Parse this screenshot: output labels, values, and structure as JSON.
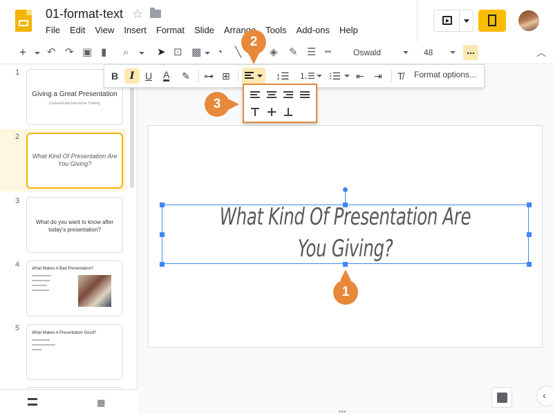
{
  "header": {
    "doc_title": "01-format-text",
    "menu": [
      "File",
      "Edit",
      "View",
      "Insert",
      "Format",
      "Slide",
      "Arrange",
      "Tools",
      "Add-ons",
      "Help"
    ]
  },
  "toolbar": {
    "font": "Oswald",
    "font_size": "48",
    "more_label": "..."
  },
  "format_toolbar": {
    "bold": "B",
    "italic": "I",
    "underline": "U",
    "text_color": "A",
    "format_options": "Format options..."
  },
  "slides": [
    {
      "num": "1",
      "title": "Giving a Great Presentation",
      "subtitle": "CustomGuide Interactive Training"
    },
    {
      "num": "2",
      "title": "What Kind Of Presentation Are You Giving?"
    },
    {
      "num": "3",
      "title": "What do you want to know after today's presentation?"
    },
    {
      "num": "4",
      "title": "What Makes A Bad Presentation?"
    },
    {
      "num": "5",
      "title": "What Makes A Presentation Good?"
    }
  ],
  "canvas": {
    "slide_text": "What Kind Of Presentation Are You Giving?"
  },
  "callouts": [
    "1",
    "2",
    "3"
  ],
  "colors": {
    "accent": "#f4b400",
    "callout": "#e8883a",
    "selection": "#4285f4",
    "highlight": "#fce8b2"
  }
}
